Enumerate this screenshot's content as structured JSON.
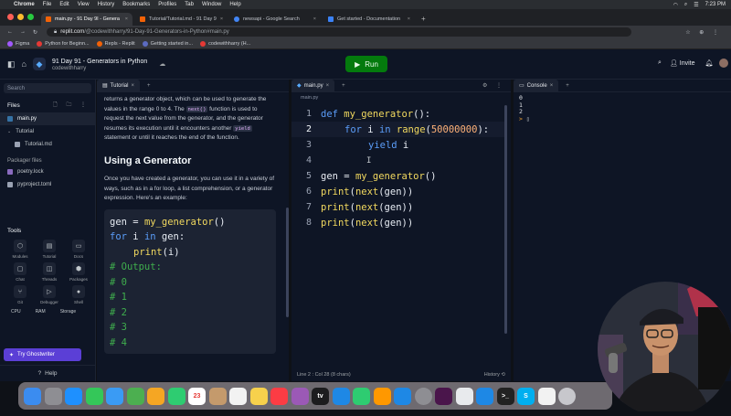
{
  "menubar": {
    "apple": "",
    "items": [
      "Chrome",
      "File",
      "Edit",
      "View",
      "History",
      "Bookmarks",
      "Profiles",
      "Tab",
      "Window",
      "Help"
    ],
    "clock": "7:23 PM"
  },
  "browser": {
    "tabs": [
      {
        "label": "main.py - 91 Day 9I - Genera",
        "color": "#f26207",
        "active": true
      },
      {
        "label": "Tutorial/Tutorial.md - 91 Day 9",
        "color": "#f26207",
        "active": false
      },
      {
        "label": "newsapi - Google Search",
        "color": "#4285f4",
        "active": false
      },
      {
        "label": "Get started - Documentation",
        "color": "#3b82f6",
        "active": false
      }
    ],
    "url_host": "replit.com",
    "url_path": "/@codewithharry/91-Day-91-Generators-in-Python#main.py",
    "bookmarks": [
      {
        "label": "Figma",
        "color": "#a259ff"
      },
      {
        "label": "Python for Beginn...",
        "color": "#e53935"
      },
      {
        "label": "Repls - Replit",
        "color": "#f26207"
      },
      {
        "label": "Getting started in...",
        "color": "#5c6bc0"
      },
      {
        "label": "codewithharry (H...",
        "color": "#e53935"
      }
    ]
  },
  "replit": {
    "project_title": "91 Day 91 - Generators in Python",
    "owner": "codewithharry",
    "run_label": "Run",
    "invite_label": "Invite"
  },
  "sidebar": {
    "search_placeholder": "Search",
    "files_heading": "Files",
    "files": [
      {
        "label": "main.py",
        "selected": true,
        "color": "#3572a5"
      },
      {
        "label": "Tutorial",
        "selected": false,
        "color": "#9aa2b3"
      },
      {
        "label": "Tutorial.md",
        "selected": false,
        "color": "#9aa2b3"
      }
    ],
    "packager_heading": "Packager files",
    "packager_files": [
      "poetry.lock",
      "pyproject.toml"
    ],
    "tools_heading": "Tools",
    "tools": [
      "Modules",
      "Tutorial",
      "Docs",
      "Chat",
      "Threads",
      "Packages",
      "Git",
      "Debugger",
      "Shell"
    ],
    "resources": [
      "CPU",
      "RAM",
      "Storage"
    ],
    "ghostwriter_label": "Try Ghostwriter",
    "help_label": "Help"
  },
  "tutorial": {
    "tab_label": "Tutorial",
    "para1_a": "returns a generator object, which can be used to generate the values in the range 0 to 4. The",
    "para1_code1": "next()",
    "para1_b": "function is used to request the next value from the generator, and the generator resumes its execution until it encounters another",
    "para1_code2": "yield",
    "para1_c": "statement or until it reaches the end of the function.",
    "heading": "Using a Generator",
    "para2": "Once you have created a generator, you can use it in a variety of ways, such as in a for loop, a list comprehension, or a generator expression. Here's an example:",
    "code": {
      "l1_var": "gen",
      "l1_eq": " = ",
      "l1_fn": "my_generator",
      "l1_paren": "()",
      "l2_for": "for",
      "l2_i": " i ",
      "l2_in": "in",
      "l2_gen": " gen:",
      "l3_fn": "print",
      "l3_args": "(i)",
      "comments": [
        "# Output:",
        "# 0",
        "# 1",
        "# 2",
        "# 3",
        "# 4"
      ]
    }
  },
  "editor": {
    "tab_label": "main.py",
    "breadcrumb": "main.py",
    "line_numbers": [
      "1",
      "2",
      "3",
      "4",
      "5",
      "6",
      "7",
      "8"
    ],
    "l1_def": "def",
    "l1_name": " my_generator",
    "l1_rest": "():",
    "l2_for": "for",
    "l2_i": " i ",
    "l2_in": "in",
    "l2_range": " range",
    "l2_open": "(",
    "l2_num": "50000000",
    "l2_close": "):",
    "l3_yield": "yield",
    "l3_i": " i",
    "l5_gen": "gen = ",
    "l5_fn": "my_generator",
    "l5_paren": "()",
    "print_fn": "print",
    "print_next": "next",
    "print_open": "(",
    "print_gen": "(gen))",
    "status": "Line 2 : Col 28 (8 chars)",
    "history": "History"
  },
  "console": {
    "tab_label": "Console",
    "output": [
      "0",
      "1",
      "2"
    ],
    "prompt": ">"
  },
  "dock": {
    "apps": [
      {
        "name": "finder",
        "color": "#3b8cf0",
        "glyph": ""
      },
      {
        "name": "launchpad",
        "color": "#8e8e93",
        "glyph": ""
      },
      {
        "name": "safari",
        "color": "#1e90ff",
        "glyph": ""
      },
      {
        "name": "messages",
        "color": "#34c759",
        "glyph": ""
      },
      {
        "name": "mail",
        "color": "#3a9bf4",
        "glyph": ""
      },
      {
        "name": "maps",
        "color": "#4caf50",
        "glyph": ""
      },
      {
        "name": "photos",
        "color": "#f5a623",
        "glyph": ""
      },
      {
        "name": "facetime",
        "color": "#2ecc71",
        "glyph": ""
      },
      {
        "name": "calendar",
        "color": "#ffffff",
        "glyph": "23"
      },
      {
        "name": "contacts",
        "color": "#c49a6c",
        "glyph": ""
      },
      {
        "name": "reminders",
        "color": "#f2f2f2",
        "glyph": ""
      },
      {
        "name": "notes",
        "color": "#f7d14c",
        "glyph": ""
      },
      {
        "name": "music",
        "color": "#fc3c44",
        "glyph": ""
      },
      {
        "name": "podcasts",
        "color": "#9b59b6",
        "glyph": ""
      },
      {
        "name": "apple-tv",
        "color": "#1c1c1e",
        "glyph": "tv"
      },
      {
        "name": "keynote",
        "color": "#1e88e5",
        "glyph": ""
      },
      {
        "name": "numbers",
        "color": "#2ecc71",
        "glyph": ""
      },
      {
        "name": "pages",
        "color": "#ff9800",
        "glyph": ""
      },
      {
        "name": "app-store",
        "color": "#1e88e5",
        "glyph": ""
      },
      {
        "name": "system-settings",
        "color": "#8e8e93",
        "glyph": ""
      },
      {
        "name": "slack",
        "color": "#4a154b",
        "glyph": ""
      },
      {
        "name": "chrome",
        "color": "#e8eaed",
        "glyph": ""
      },
      {
        "name": "vscode",
        "color": "#1e88e5",
        "glyph": ""
      },
      {
        "name": "terminal",
        "color": "#222222",
        "glyph": ">_"
      },
      {
        "name": "skype",
        "color": "#00aff0",
        "glyph": "S"
      },
      {
        "name": "icloud",
        "color": "#f2f2f2",
        "glyph": ""
      },
      {
        "name": "trash",
        "color": "#c7c7cc",
        "glyph": ""
      }
    ]
  }
}
